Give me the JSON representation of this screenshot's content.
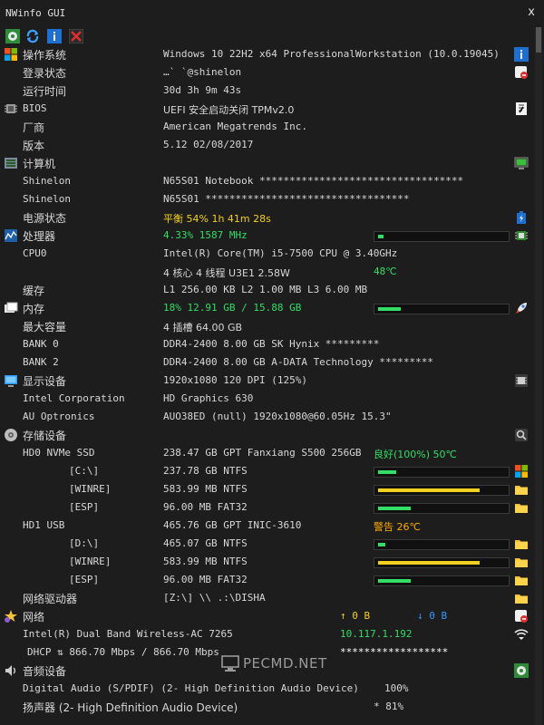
{
  "window": {
    "title": "NWinfo GUI",
    "close": "x"
  },
  "rows": {
    "os": {
      "label": "操作系统",
      "value": "Windows 10 22H2 x64 ProfessionalWorkstation (10.0.19045)"
    },
    "login": {
      "label": "登录状态",
      "value": "…` `@shinelon"
    },
    "uptime": {
      "label": "运行时间",
      "value": "30d 3h 9m 43s"
    },
    "bios": {
      "label": "BIOS",
      "value": "UEFI 安全启动关闭 TPMv2.0"
    },
    "vendor": {
      "label": "厂商",
      "value": "American Megatrends Inc."
    },
    "version": {
      "label": "版本",
      "value": "5.12 02/08/2017"
    },
    "computer": {
      "label": "计算机"
    },
    "shinelon1": {
      "label": "Shinelon",
      "value": "N65S01 Notebook **********************************"
    },
    "shinelon2": {
      "label": "Shinelon",
      "value": "N65S01 **********************************"
    },
    "power": {
      "label": "电源状态",
      "value": "平衡 54% 1h 41m 28s"
    },
    "cpu": {
      "label": "处理器",
      "value": "4.33% 1587 MHz",
      "usage": 0.0433
    },
    "cpu0": {
      "label": "CPU0",
      "value": "Intel(R) Core(TM) i5-7500 CPU @ 3.40GHz"
    },
    "cores": {
      "value": "4 核心 4 线程 U3E1 2.58W",
      "temp": "48℃"
    },
    "cache": {
      "label": "缓存",
      "value": "L1 256.00 KB L2 1.00 MB L3 6.00 MB"
    },
    "memory": {
      "label": "内存",
      "value": "18% 12.91 GB / 15.88 GB",
      "usage": 0.18
    },
    "maxcap": {
      "label": "最大容量",
      "value": "4 插槽 64.00 GB"
    },
    "bank0": {
      "label": "BANK 0",
      "value": "DDR4-2400 8.00 GB SK Hynix *********"
    },
    "bank2": {
      "label": "BANK 2",
      "value": "DDR4-2400 8.00 GB A-DATA Technology *********"
    },
    "display": {
      "label": "显示设备",
      "value": "1920x1080 120 DPI (125%)"
    },
    "intel": {
      "label": "Intel Corporation",
      "value": "HD Graphics 630"
    },
    "auo": {
      "label": "AU Optronics",
      "value": "AUO38ED (null) 1920x1080@60.05Hz 15.3\""
    },
    "storage": {
      "label": "存储设备"
    },
    "hd0": {
      "label": "HD0 NVMe SSD",
      "value": "238.47 GB GPT Fanxiang S500 256GB",
      "status": "良好(100%) 50℃"
    },
    "c": {
      "label": "[C:\\]",
      "value": "237.78 GB NTFS",
      "usage": 0.14
    },
    "winre1": {
      "label": "[WINRE]",
      "value": "583.99 MB NTFS",
      "usage": 0.8
    },
    "esp1": {
      "label": "[ESP]",
      "value": "96.00 MB FAT32",
      "usage": 0.26
    },
    "hd1": {
      "label": "HD1 USB",
      "value": "465.76 GB GPT INIC-3610",
      "status": "警告 26℃"
    },
    "d": {
      "label": "[D:\\]",
      "value": "465.07 GB NTFS",
      "usage": 0.06
    },
    "winre2": {
      "label": "[WINRE]",
      "value": "583.99 MB NTFS",
      "usage": 0.8
    },
    "esp2": {
      "label": "[ESP]",
      "value": "96.00 MB FAT32",
      "usage": 0.26
    },
    "netdrive": {
      "label": "网络驱动器",
      "value": "[Z:\\] \\\\  .:\\DISHA"
    },
    "network": {
      "label": "网络",
      "up": "↑ 0 B",
      "down": "↓ 0 B"
    },
    "wifi": {
      "label": "Intel(R) Dual Band Wireless-AC 7265",
      "value": "10.117.1.192"
    },
    "dhcp": {
      "label": "DHCP ⇅ 866.70 Mbps / 866.70 Mbps",
      "value": "******************"
    },
    "audio": {
      "label": "音频设备"
    },
    "spdif": {
      "label": "Digital Audio (S/PDIF) (2- High Definition Audio Device)",
      "value": "100%"
    },
    "speaker": {
      "label": "扬声器 (2- High Definition Audio Device)",
      "value": "* 81%"
    }
  },
  "watermark": {
    "text": "PECMD.NET"
  },
  "colors": {
    "ok": "#33dd66",
    "warn": "#ffaa00",
    "yellow": "#f2d020",
    "down": "#3399ff"
  }
}
